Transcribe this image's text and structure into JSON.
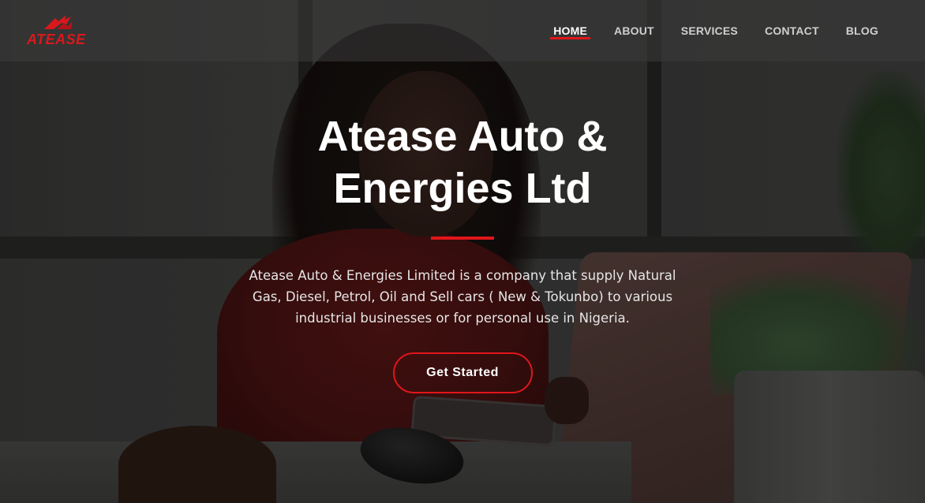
{
  "brand": {
    "name": "ATEASE",
    "logo_icon": "arrow-logo-icon",
    "accent_color": "#e0161b"
  },
  "nav": {
    "items": [
      {
        "label": "HOME",
        "active": true
      },
      {
        "label": "ABOUT",
        "active": false
      },
      {
        "label": "SERVICES",
        "active": false
      },
      {
        "label": "CONTACT",
        "active": false
      },
      {
        "label": "BLOG",
        "active": false
      }
    ]
  },
  "hero": {
    "title": "Atease Auto & Energies Ltd",
    "description": "Atease Auto & Energies Limited is a company that supply Natural Gas, Diesel, Petrol, Oil and Sell cars ( New & Tokunbo) to various industrial businesses or for personal use in Nigeria.",
    "cta_label": "Get Started"
  }
}
